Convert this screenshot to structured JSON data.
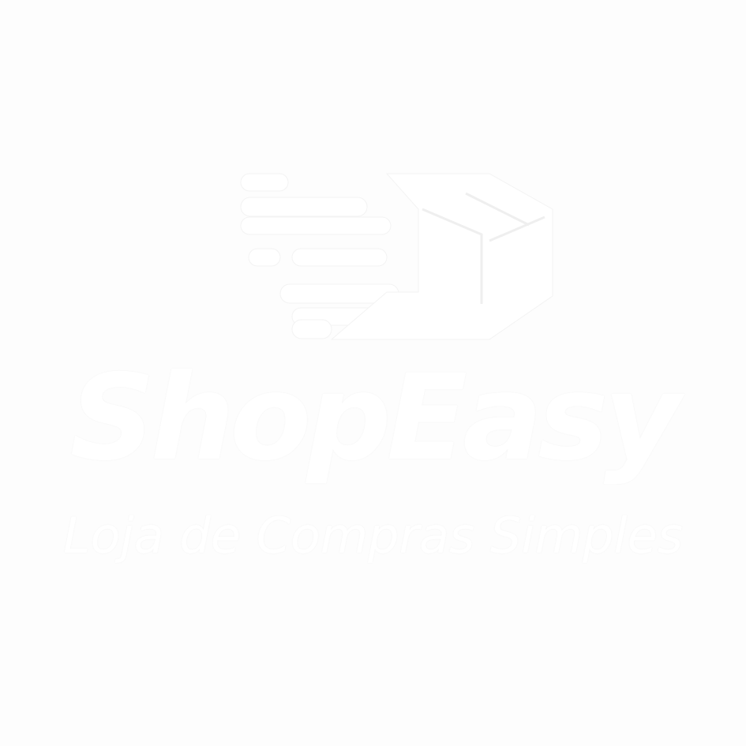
{
  "brand": {
    "name": "ShopEasy",
    "tagline": "Loja de Compras Simples",
    "logo_icon": "delivery-box-icon",
    "logo_color": "#ffffff",
    "background_color": "#fdfdfd"
  }
}
